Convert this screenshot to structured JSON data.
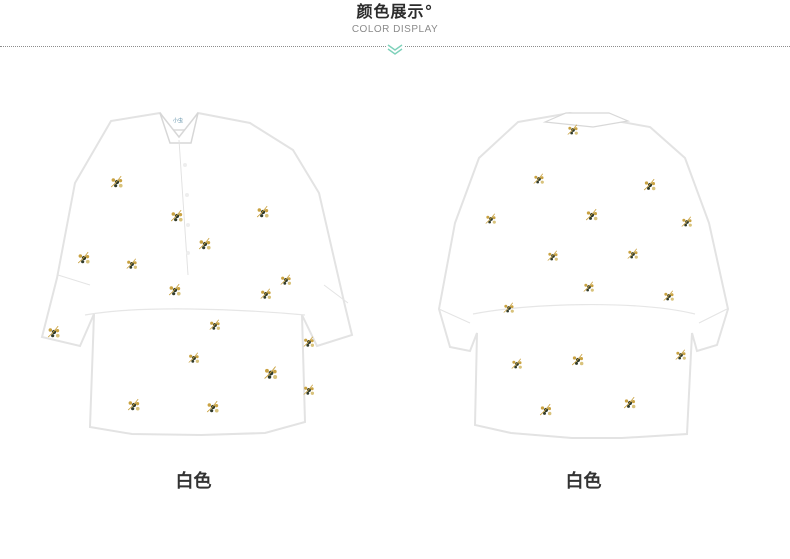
{
  "header": {
    "title": "颜色展示°",
    "subtitle": "COLOR DISPLAY"
  },
  "products": [
    {
      "color_label": "白色",
      "view": "front"
    },
    {
      "color_label": "白色",
      "view": "back"
    }
  ],
  "colors": {
    "text": "#333333",
    "muted": "#8b8b8b",
    "accent": "#7ed1ba",
    "shirt": "#ffffff",
    "embroidery_yellow": "#c9a241",
    "embroidery_dark": "#313b2b"
  },
  "icons": {
    "divider_chevron": "chevron-double-down-icon"
  }
}
